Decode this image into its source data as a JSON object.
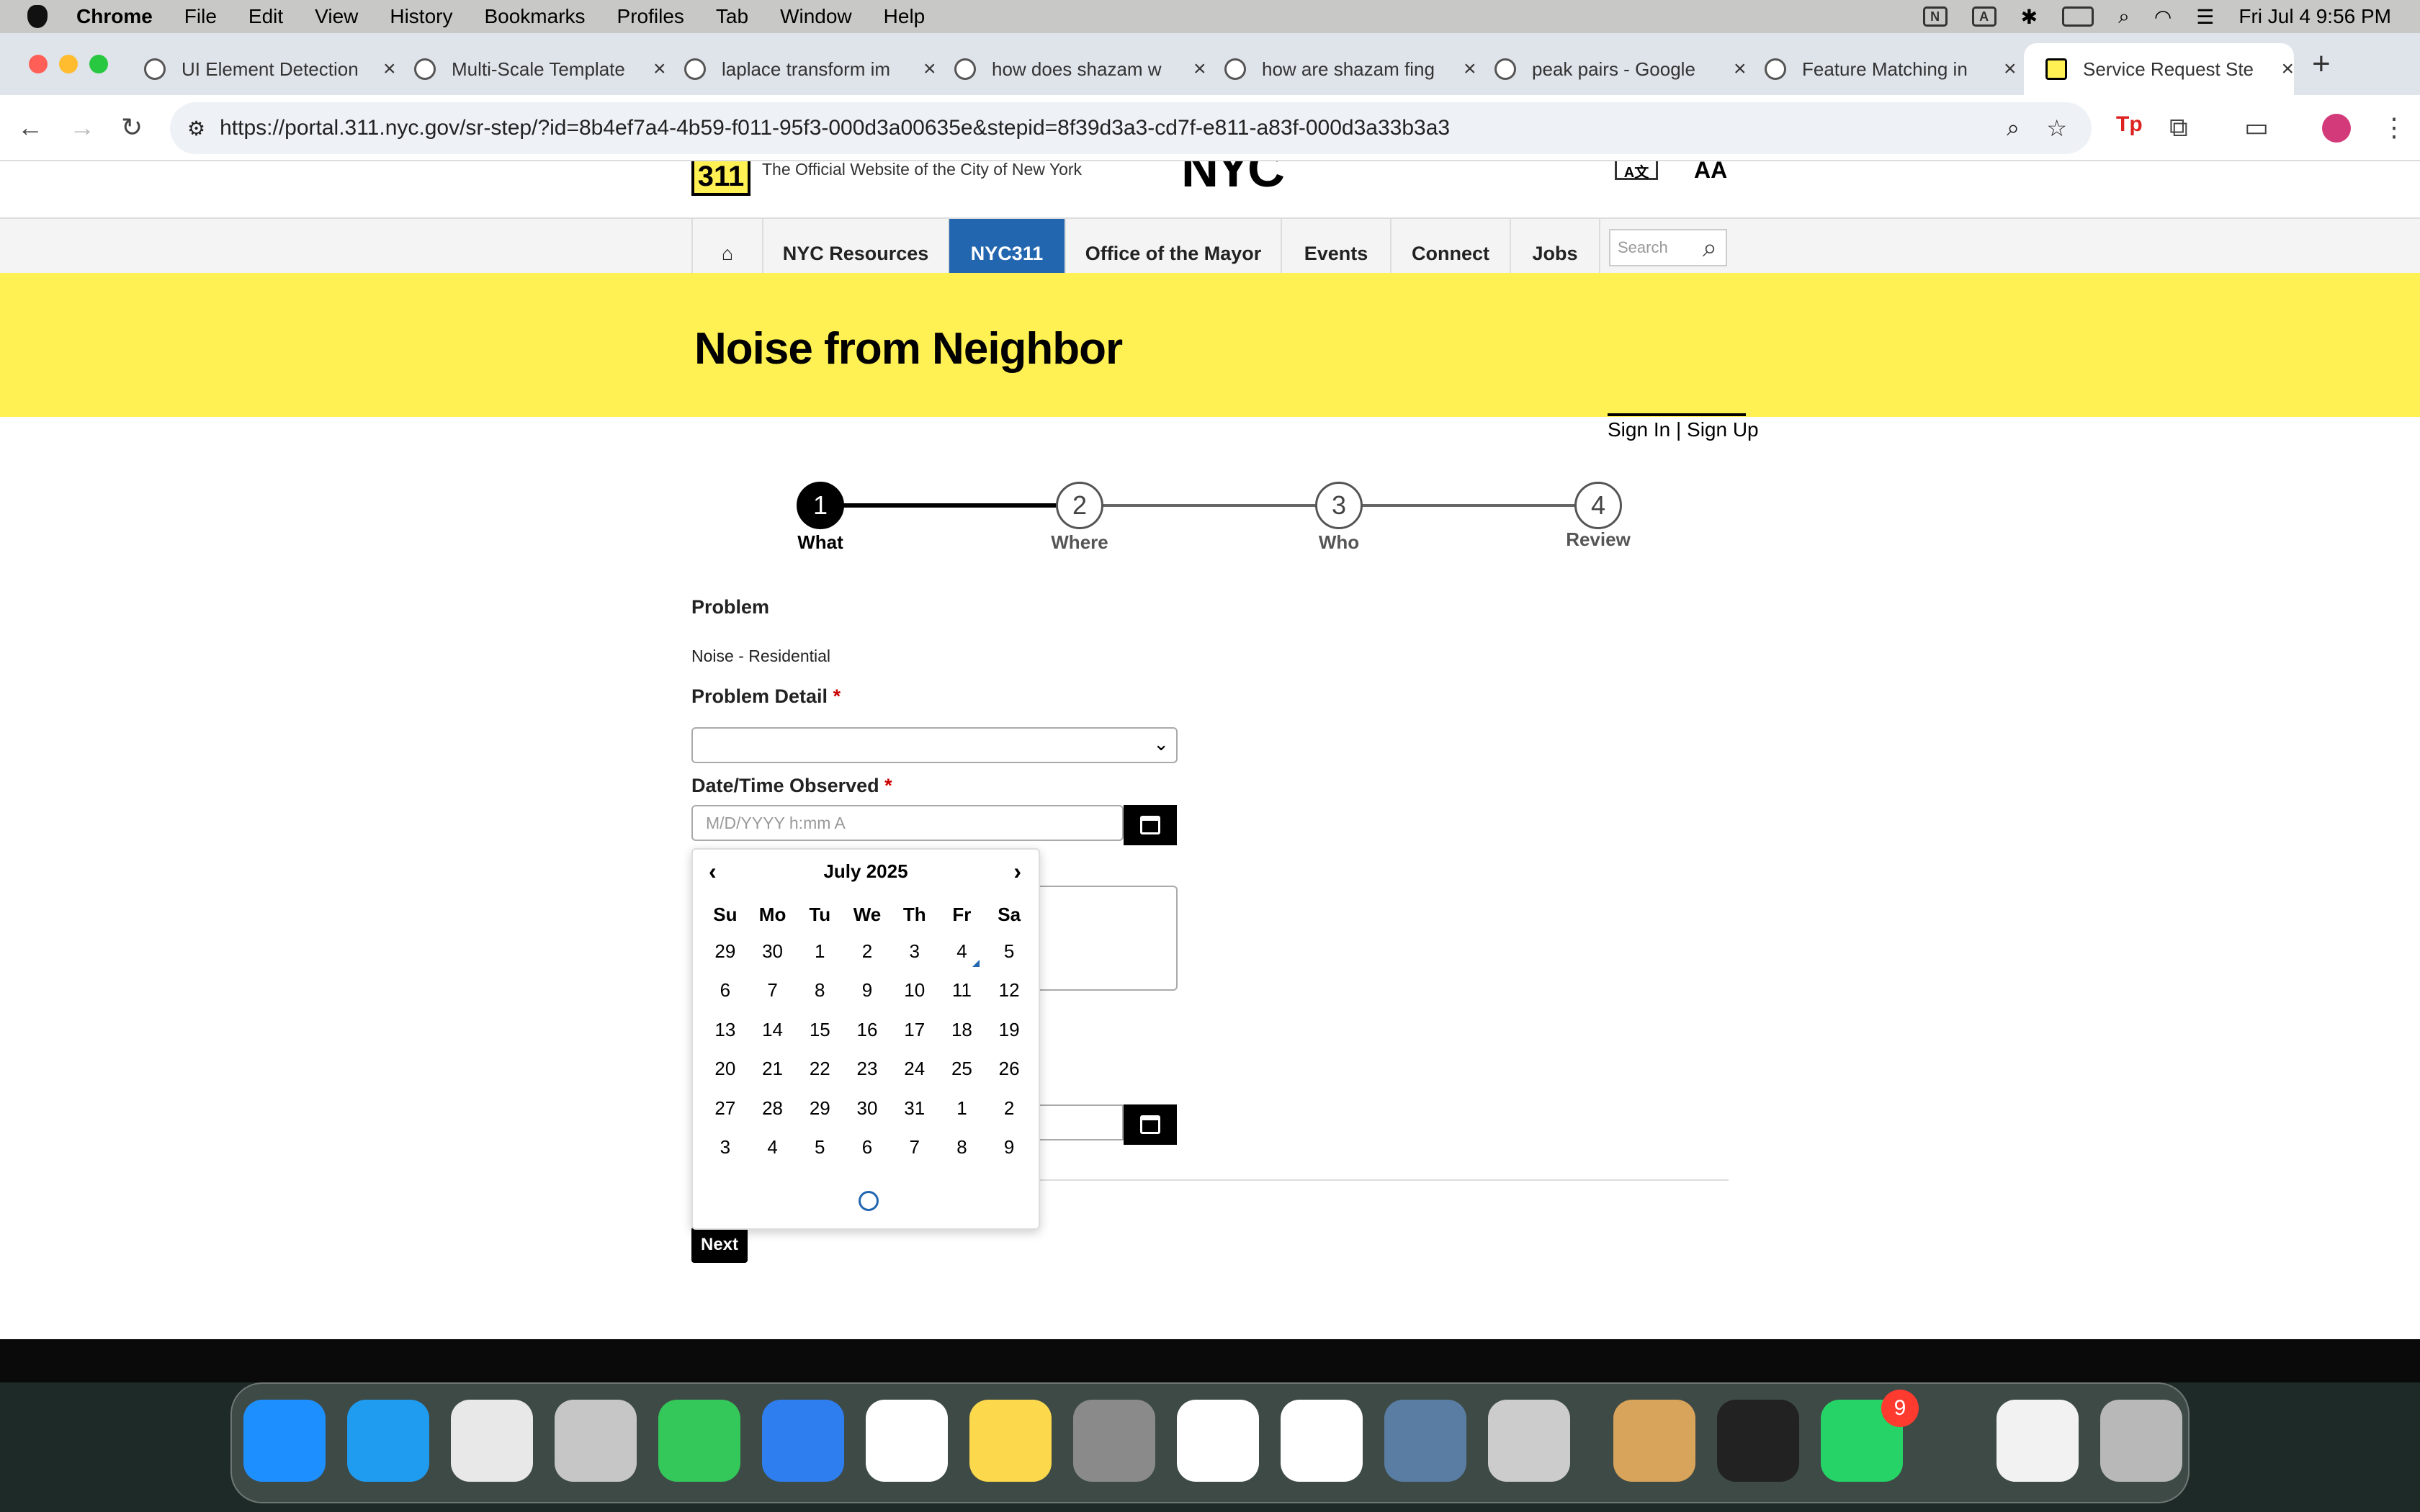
{
  "menubar": {
    "app": "Chrome",
    "items": [
      "File",
      "Edit",
      "View",
      "History",
      "Bookmarks",
      "Profiles",
      "Tab",
      "Window",
      "Help"
    ],
    "datetime": "Fri Jul 4  9:56 PM"
  },
  "tabs": [
    {
      "title": "UI Element Detection"
    },
    {
      "title": "Multi-Scale Template"
    },
    {
      "title": "laplace transform im"
    },
    {
      "title": "how does shazam w"
    },
    {
      "title": "how are shazam fing"
    },
    {
      "title": "peak pairs - Google"
    },
    {
      "title": "Feature Matching in"
    },
    {
      "title": "Service Request Ste",
      "active": true
    }
  ],
  "url": "https://portal.311.nyc.gov/sr-step/?id=8b4ef7a4-4b59-f011-95f3-000d3a00635e&stepid=8f39d3a3-cd7f-e811-a83f-000d3a33b3a3",
  "site": {
    "logo": "311",
    "tagline": "The Official Website of the City of New York",
    "nyc_logo": "NYC",
    "nav": [
      "NYC Resources",
      "NYC311",
      "Office of the Mayor",
      "Events",
      "Connect",
      "Jobs"
    ],
    "search_placeholder": "Search",
    "page_title": "Noise from Neighbor",
    "sign_in": "Sign In",
    "sign_sep": "|",
    "sign_up": "Sign Up"
  },
  "steps": [
    {
      "num": "1",
      "label": "What",
      "active": true
    },
    {
      "num": "2",
      "label": "Where"
    },
    {
      "num": "3",
      "label": "Who"
    },
    {
      "num": "4",
      "label": "Review"
    }
  ],
  "form": {
    "problem_label": "Problem",
    "problem_value": "Noise - Residential",
    "detail_label": "Problem Detail",
    "required_mark": "*",
    "date_label": "Date/Time Observed",
    "date_placeholder": "M/D/YYYY h:mm A",
    "next_label": "Next"
  },
  "calendar": {
    "month": "July 2025",
    "weekdays": [
      "Su",
      "Mo",
      "Tu",
      "We",
      "Th",
      "Fr",
      "Sa"
    ],
    "days": [
      "29",
      "30",
      "1",
      "2",
      "3",
      "4",
      "5",
      "6",
      "7",
      "8",
      "9",
      "10",
      "11",
      "12",
      "13",
      "14",
      "15",
      "16",
      "17",
      "18",
      "19",
      "20",
      "21",
      "22",
      "23",
      "24",
      "25",
      "26",
      "27",
      "28",
      "29",
      "30",
      "31",
      "1",
      "2",
      "3",
      "4",
      "5",
      "6",
      "7",
      "8",
      "9"
    ],
    "today": "4"
  },
  "dock": {
    "badge_whatsapp": "9"
  }
}
